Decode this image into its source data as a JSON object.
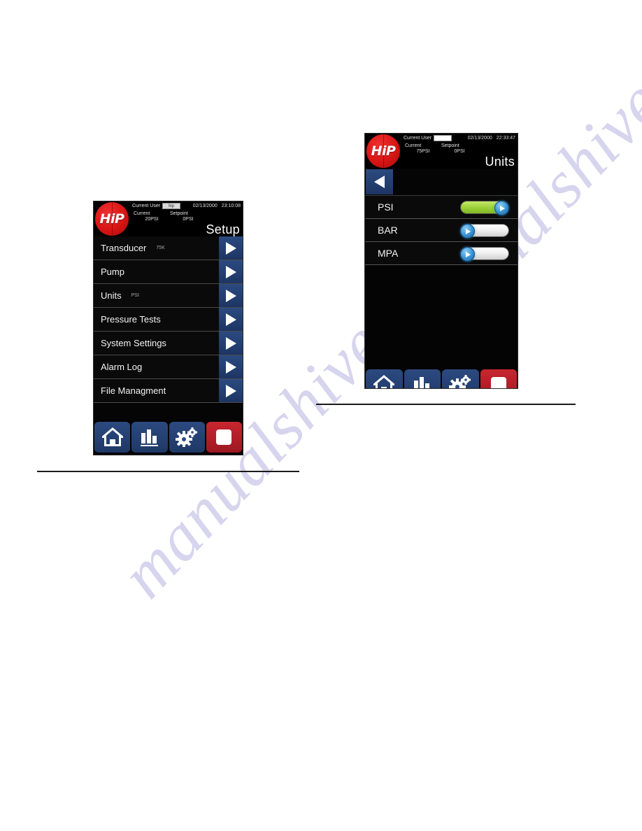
{
  "watermark": {
    "text": "manualshive.com"
  },
  "panels": [
    {
      "id": "setup",
      "header": {
        "logo_text": "HiP",
        "current_user_label": "Current User",
        "current_user_value": "hip",
        "date": "02/13/2000",
        "time": "23:10:08",
        "current_label": "Current",
        "setpoint_label": "Setpoint",
        "current_value": "20PSI",
        "setpoint_value": "0PSI",
        "title": "Setup"
      },
      "list": [
        {
          "label": "Transducer",
          "value": "75K",
          "arrow_icon": "triangle-right-icon"
        },
        {
          "label": "Pump",
          "value": "",
          "arrow_icon": "triangle-right-icon"
        },
        {
          "label": "Units",
          "value": "PSI",
          "arrow_icon": "triangle-right-icon"
        },
        {
          "label": "Pressure Tests",
          "value": "",
          "arrow_icon": "triangle-right-icon"
        },
        {
          "label": "System Settings",
          "value": "",
          "arrow_icon": "triangle-right-icon"
        },
        {
          "label": "Alarm Log",
          "value": "",
          "arrow_icon": "triangle-right-icon"
        },
        {
          "label": "File Managment",
          "value": "",
          "arrow_icon": "triangle-right-icon"
        }
      ],
      "toolbar": [
        {
          "name": "home",
          "icon": "home-icon",
          "color": "#2c4a80"
        },
        {
          "name": "chart",
          "icon": "bar-chart-icon",
          "color": "#2c4a80"
        },
        {
          "name": "setup",
          "icon": "gears-icon",
          "color": "#2c4a80"
        },
        {
          "name": "stop",
          "icon": "stop-icon",
          "color": "#c9262f"
        }
      ]
    },
    {
      "id": "units",
      "header": {
        "logo_text": "HiP",
        "current_user_label": "Current User",
        "current_user_value": "",
        "date": "02/13/2000",
        "time": "22:33:47",
        "current_label": "Current",
        "setpoint_label": "Setpoint",
        "current_value": "75PSI",
        "setpoint_value": "0PSI",
        "title": "Units"
      },
      "back_icon": "triangle-left-icon",
      "toggles": [
        {
          "label": "PSI",
          "state": "on",
          "track_on_color": "#9ed23a",
          "knob_icon": "triangle-right-icon"
        },
        {
          "label": "BAR",
          "state": "off",
          "track_off_color": "#ffffff",
          "knob_icon": "triangle-right-icon"
        },
        {
          "label": "MPA",
          "state": "off",
          "track_off_color": "#ffffff",
          "knob_icon": "triangle-right-icon"
        }
      ],
      "toolbar": [
        {
          "name": "home",
          "icon": "home-icon",
          "color": "#2c4a80"
        },
        {
          "name": "chart",
          "icon": "bar-chart-icon",
          "color": "#2c4a80"
        },
        {
          "name": "setup",
          "icon": "gears-icon",
          "color": "#2c4a80"
        },
        {
          "name": "stop",
          "icon": "stop-icon",
          "color": "#c9262f"
        }
      ]
    }
  ]
}
